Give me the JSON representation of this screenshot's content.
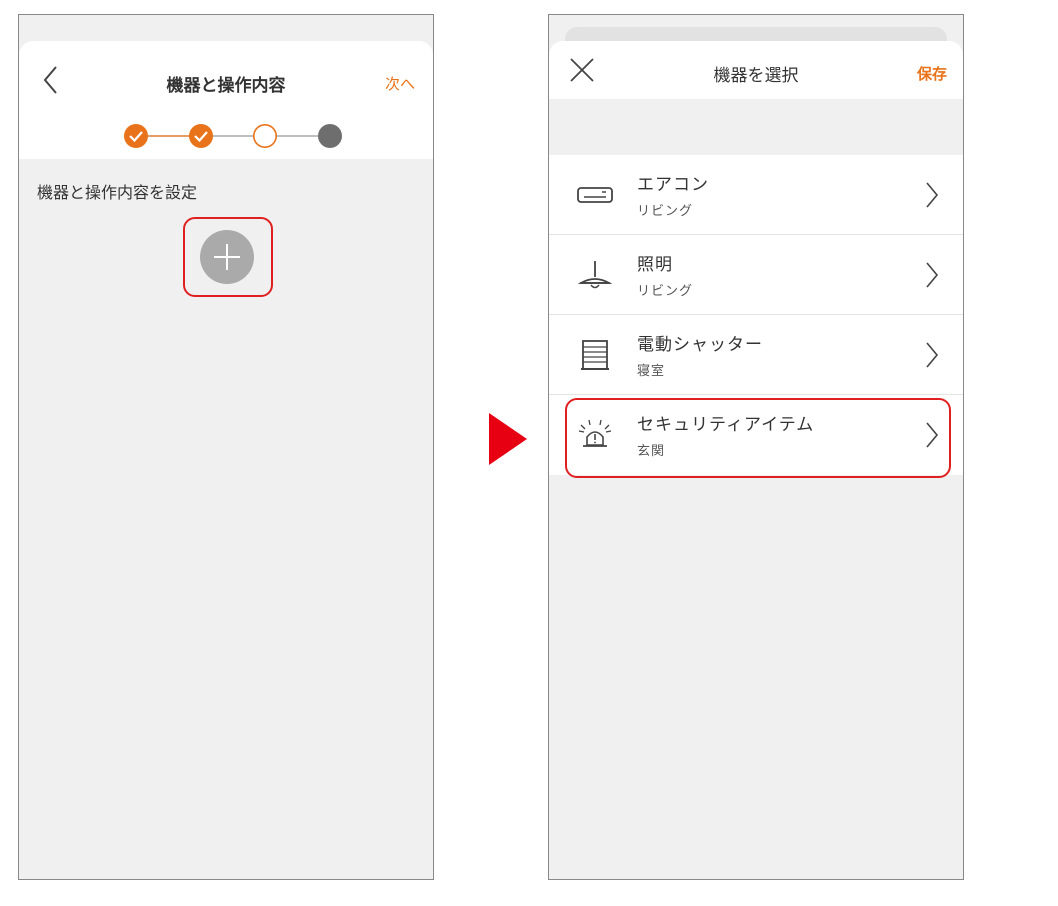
{
  "left_screen": {
    "title": "機器と操作内容",
    "next_label": "次へ",
    "section_label": "機器と操作内容を設定",
    "steps": [
      "completed",
      "completed",
      "current",
      "pending"
    ]
  },
  "right_screen": {
    "title": "機器を選択",
    "save_label": "保存",
    "devices": [
      {
        "name": "エアコン",
        "room": "リビング",
        "icon": "air-conditioner-icon"
      },
      {
        "name": "照明",
        "room": "リビング",
        "icon": "pendant-light-icon"
      },
      {
        "name": "電動シャッター",
        "room": "寝室",
        "icon": "shutter-icon"
      },
      {
        "name": "セキュリティアイテム",
        "room": "玄関",
        "icon": "alarm-siren-icon"
      }
    ]
  },
  "colors": {
    "accent": "#e8731a",
    "highlight": "#e02020",
    "arrow": "#e60012",
    "step_pending": "#6e6e6e",
    "add_button": "#aaaaaa",
    "background": "#f0f0f0"
  }
}
